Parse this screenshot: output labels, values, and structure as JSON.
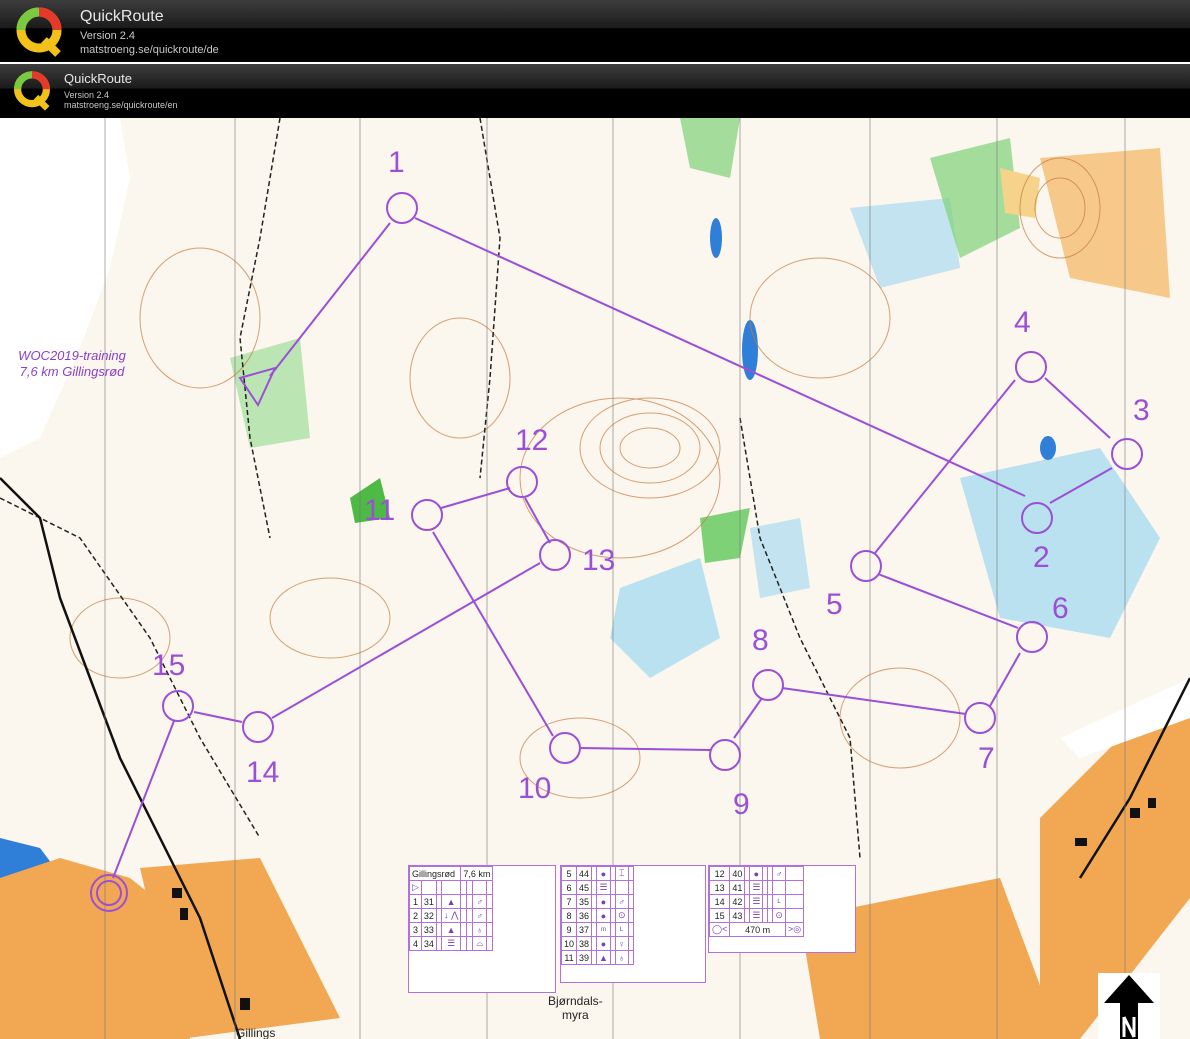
{
  "headers": [
    {
      "app_name": "QuickRoute",
      "version": "Version 2.4",
      "url": "matstroeng.se/quickroute/de"
    },
    {
      "app_name": "QuickRoute",
      "version": "Version 2.4",
      "url": "matstroeng.se/quickroute/en"
    }
  ],
  "map": {
    "event_title_line1": "WOC2019-training",
    "event_title_line2": "7,6 km Gillingsrød",
    "course_color": "#9a4fd6",
    "controls": [
      {
        "number": "1"
      },
      {
        "number": "2"
      },
      {
        "number": "3"
      },
      {
        "number": "4"
      },
      {
        "number": "5"
      },
      {
        "number": "6"
      },
      {
        "number": "7"
      },
      {
        "number": "8"
      },
      {
        "number": "9"
      },
      {
        "number": "10"
      },
      {
        "number": "11"
      },
      {
        "number": "12"
      },
      {
        "number": "13"
      },
      {
        "number": "14"
      },
      {
        "number": "15"
      }
    ],
    "place_labels": {
      "bjorndals_line1": "Bjørndals-",
      "bjorndals_line2": "myra",
      "gillings": "Gillings"
    }
  },
  "description_sheet": {
    "event": "Gillingsrød",
    "length": "7,6 km",
    "start_symbol": "▷",
    "rows_col1": [
      {
        "n": "1",
        "code": "31",
        "c": "▲",
        "f": "♂"
      },
      {
        "n": "2",
        "code": "32",
        "c": "↓ ⋀",
        "f": "♂"
      },
      {
        "n": "3",
        "code": "33",
        "c": "▲",
        "f": "♁"
      },
      {
        "n": "4",
        "code": "34",
        "c": "☰",
        "f": "⌓"
      }
    ],
    "rows_col2": [
      {
        "n": "5",
        "code": "44",
        "c": "●",
        "f": "⌶"
      },
      {
        "n": "6",
        "code": "45",
        "c": "☰",
        "f": ""
      },
      {
        "n": "7",
        "code": "35",
        "c": "●",
        "f": "♂"
      },
      {
        "n": "8",
        "code": "36",
        "c": "●",
        "f": "⊙"
      },
      {
        "n": "9",
        "code": "37",
        "c": "ᵐ",
        "f": "ᴸ"
      },
      {
        "n": "10",
        "code": "38",
        "c": "●",
        "f": "♀"
      },
      {
        "n": "11",
        "code": "39",
        "c": "▲",
        "f": "♁"
      }
    ],
    "rows_col3": [
      {
        "n": "12",
        "code": "40",
        "c": "●",
        "f": "♂"
      },
      {
        "n": "13",
        "code": "41",
        "c": "☰",
        "f": ""
      },
      {
        "n": "14",
        "code": "42",
        "c": "☰",
        "f": "ᴸ"
      },
      {
        "n": "15",
        "code": "43",
        "c": "☰",
        "f": "⊙"
      }
    ],
    "finish_distance": "470 m"
  },
  "icons": [
    "quickroute-logo-icon",
    "north-arrow-icon"
  ]
}
